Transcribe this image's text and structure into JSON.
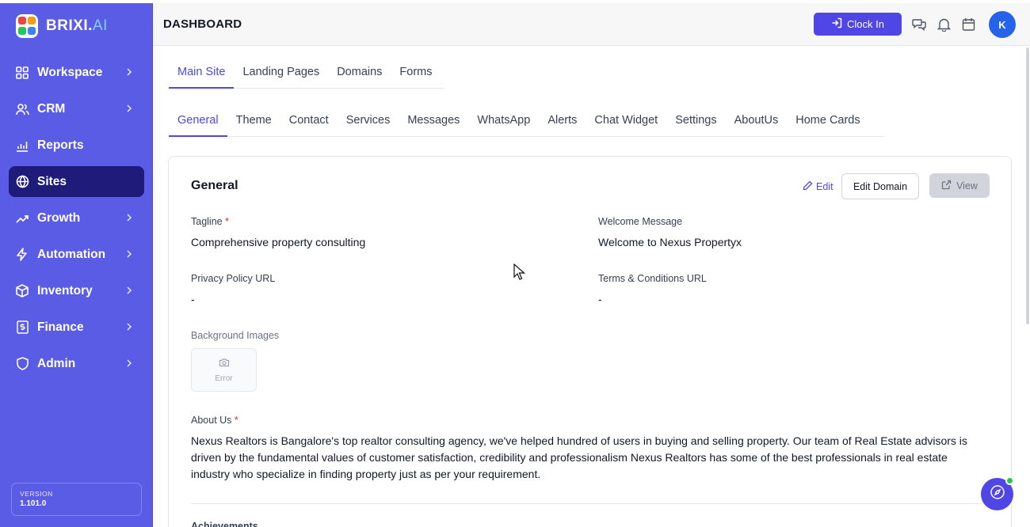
{
  "brand": {
    "name": "BRIXI.",
    "suffix": "AI"
  },
  "sidebar": {
    "items": [
      {
        "label": "Workspace",
        "icon": "grid-icon",
        "chevron": true
      },
      {
        "label": "CRM",
        "icon": "users-icon",
        "chevron": true
      },
      {
        "label": "Reports",
        "icon": "bar-chart-icon",
        "chevron": false
      },
      {
        "label": "Sites",
        "icon": "globe-icon",
        "chevron": false,
        "active": true
      },
      {
        "label": "Growth",
        "icon": "trending-up-icon",
        "chevron": true
      },
      {
        "label": "Automation",
        "icon": "lightning-icon",
        "chevron": true
      },
      {
        "label": "Inventory",
        "icon": "box-icon",
        "chevron": true
      },
      {
        "label": "Finance",
        "icon": "dollar-doc-icon",
        "chevron": true
      },
      {
        "label": "Admin",
        "icon": "shield-icon",
        "chevron": true
      }
    ],
    "version_label": "VERSION",
    "version_number": "1.101.0"
  },
  "header": {
    "title": "DASHBOARD",
    "clock_in_label": "Clock In",
    "avatar_initial": "K"
  },
  "tabs_primary": [
    "Main Site",
    "Landing Pages",
    "Domains",
    "Forms"
  ],
  "tabs_secondary": [
    "General",
    "Theme",
    "Contact",
    "Services",
    "Messages",
    "WhatsApp",
    "Alerts",
    "Chat Widget",
    "Settings",
    "AboutUs",
    "Home Cards"
  ],
  "card": {
    "title": "General",
    "edit_label": "Edit",
    "edit_domain_label": "Edit Domain",
    "view_label": "View",
    "tagline_label": "Tagline",
    "tagline_value": "Comprehensive property consulting",
    "welcome_label": "Welcome Message",
    "welcome_value": "Welcome to Nexus Propertyx",
    "privacy_label": "Privacy Policy URL",
    "privacy_value": "-",
    "terms_label": "Terms & Conditions URL",
    "terms_value": "-",
    "bg_images_label": "Background Images",
    "bg_images_error": "Error",
    "about_label": "About Us",
    "about_text": "Nexus Realtors is Bangalore's top realtor consulting agency, we've helped hundred of users in buying and selling property. Our team of Real Estate advisors is driven by the fundamental values of customer satisfaction, credibility and professionalism Nexus Realtors has some of the best professionals in real estate industry who specialize in finding property just as per your requirement.",
    "achievements_label": "Achievements",
    "required_mark": "*"
  },
  "colors": {
    "sidebar": "#5b5ce6",
    "sidebar_active": "#1e1b7a",
    "accent": "#4f46e5",
    "avatar": "#2563eb",
    "status_dot": "#22c55e"
  }
}
